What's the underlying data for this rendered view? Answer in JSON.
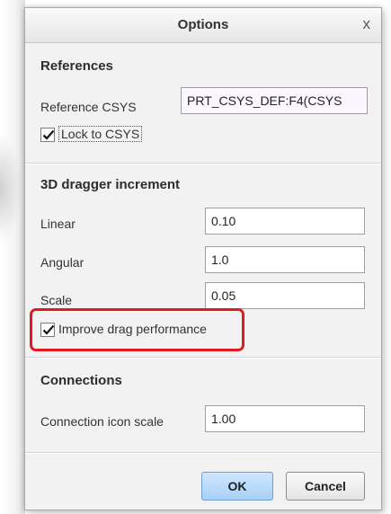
{
  "window": {
    "title": "Options",
    "close_glyph": "x"
  },
  "references": {
    "section_title": "References",
    "csys_label": "Reference CSYS",
    "csys_value": "PRT_CSYS_DEF:F4(CSYS",
    "lock_label": "Lock to CSYS",
    "lock_checked": true
  },
  "dragger": {
    "section_title": "3D dragger increment",
    "linear_label": "Linear",
    "linear_value": "0.10",
    "angular_label": "Angular",
    "angular_value": "1.0",
    "scale_label": "Scale",
    "scale_value": "0.05",
    "improve_label": "Improve drag performance",
    "improve_checked": true
  },
  "connections": {
    "section_title": "Connections",
    "icon_scale_label": "Connection icon scale",
    "icon_scale_value": "1.00"
  },
  "buttons": {
    "ok_label": "OK",
    "cancel_label": "Cancel"
  },
  "colors": {
    "highlight": "#e11a22",
    "ok_button": "#a9d0f7"
  }
}
